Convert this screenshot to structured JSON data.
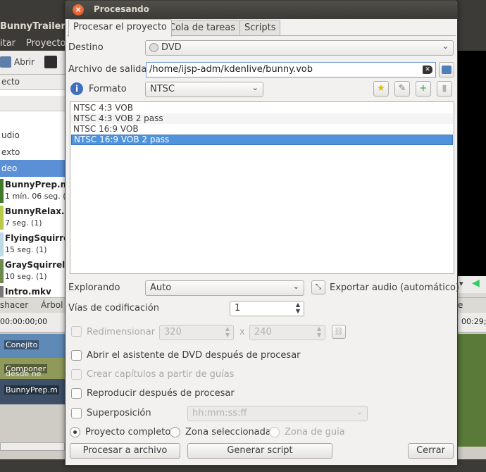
{
  "background": {
    "window_title": "BunnyTrailer.kde",
    "menu": [
      "itar",
      "Proyecto"
    ],
    "toolbar_open": "Abrir",
    "panel_header": "ecto",
    "types": [
      "udio",
      "exto",
      "deo"
    ],
    "clips": [
      {
        "name": "BunnyPrep.m",
        "duration": "1 mín. 06 seg. (",
        "color": "#3f7a2a"
      },
      {
        "name": "BunnyRelax.m",
        "duration": "7 seg. (1)",
        "color": "#b9c94a"
      },
      {
        "name": "FlyingSquirre",
        "duration": "15 seg. (1)",
        "color": "#bcd9e8"
      },
      {
        "name": "GraySquirrel.m",
        "duration": "10 seg. (1)",
        "color": "#6d8a4a"
      },
      {
        "name": "Intro.mkv",
        "duration": "",
        "color": "#777"
      }
    ],
    "bottom_tabs": [
      "shacer",
      "Árbol"
    ],
    "right_tab": "e proye",
    "timecode_left": "00:00:00;00",
    "timecode_right": "00:29;",
    "track_clips": [
      "Conejito",
      "Componer",
      "BunnyPrep.m"
    ],
    "track_hint": "desde ne"
  },
  "dialog": {
    "title": "Procesando",
    "tabs": [
      "Procesar el proyecto",
      "Cola de tareas",
      "Scripts"
    ],
    "destino_label": "Destino",
    "destino_value": "DVD",
    "archivo_label": "Archivo de salida",
    "archivo_value": "/home/ijsp-adm/kdenlive/bunny.vob",
    "formato_label": "Formato",
    "formato_value": "NTSC",
    "profiles": [
      "NTSC 4:3 VOB",
      "NTSC 4:3 VOB 2 pass",
      "NTSC 16:9 VOB",
      "NTSC 16:9 VOB 2 pass"
    ],
    "selected_profile_index": 3,
    "explorando_label": "Explorando",
    "explorando_value": "Auto",
    "exportar_audio_label": "Exportar audio (automático)",
    "vias_label": "Vías de codificación",
    "vias_value": "1",
    "redimensionar_label": "Redimensionar",
    "width_value": "320",
    "times": "x",
    "height_value": "240",
    "abrir_asistente_label": "Abrir el asistente de DVD después de procesar",
    "crear_capitulos_label": "Crear capítulos a partir de guías",
    "reproducir_label": "Reproducir después de procesar",
    "superposicion_label": "Superposición",
    "superposicion_value": "hh:mm:ss:ff",
    "proyecto_completo_label": "Proyecto completo",
    "zona_seleccionada_label": "Zona seleccionada",
    "zona_guia_label": "Zona de guía",
    "procesar_btn": "Procesar a archivo",
    "generar_btn": "Generar script",
    "cerrar_btn": "Cerrar"
  }
}
